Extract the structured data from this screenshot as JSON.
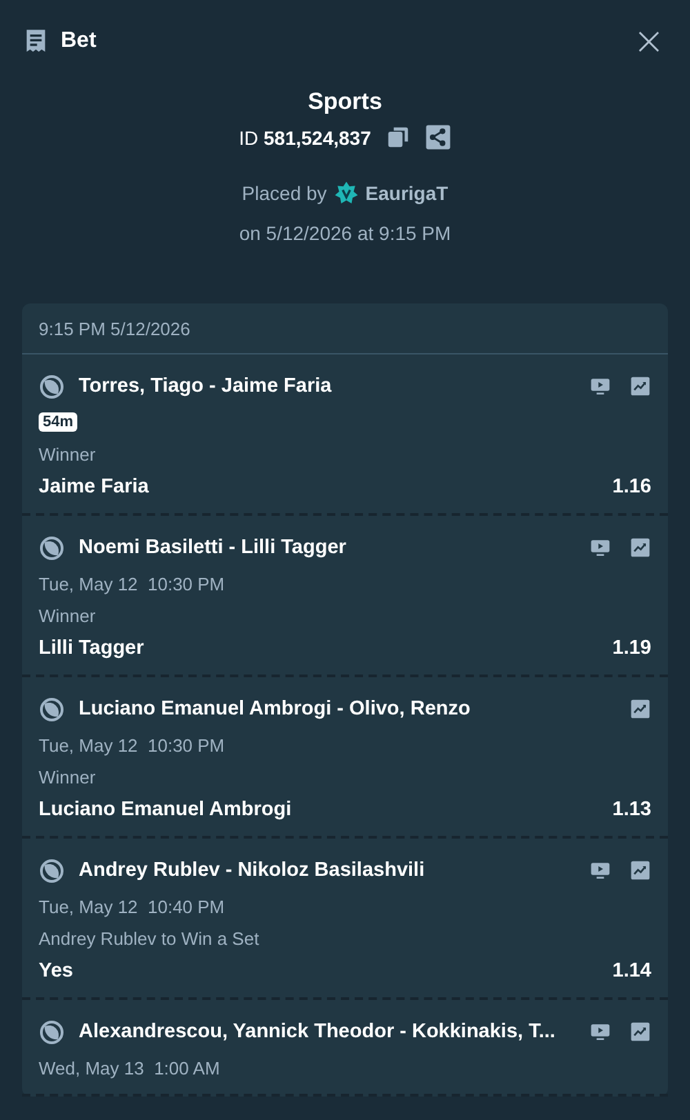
{
  "header": {
    "title": "Bet",
    "close": "×"
  },
  "summary": {
    "category": "Sports",
    "id_label": "ID",
    "id_value": "581,524,837",
    "placed_by": "Placed by",
    "user": "EaurigaT",
    "placed_on": "on 5/12/2026 at 9:15 PM"
  },
  "card": {
    "timestamp": "9:15 PM 5/12/2026",
    "legs": [
      {
        "event": "Torres, Tiago - Jaime Faria",
        "badge": "54m",
        "stream": true,
        "stats": true,
        "market": "Winner",
        "selection": "Jaime Faria",
        "odds": "1.16"
      },
      {
        "event": "Noemi Basiletti - Lilli Tagger",
        "time": "Tue, May 12  10:30 PM",
        "stream": true,
        "stats": true,
        "market": "Winner",
        "selection": "Lilli Tagger",
        "odds": "1.19"
      },
      {
        "event": "Luciano Emanuel Ambrogi - Olivo, Renzo",
        "time": "Tue, May 12  10:30 PM",
        "stream": false,
        "stats": true,
        "market": "Winner",
        "selection": "Luciano Emanuel Ambrogi",
        "odds": "1.13"
      },
      {
        "event": "Andrey Rublev - Nikoloz Basilashvili",
        "time": "Tue, May 12  10:40 PM",
        "stream": true,
        "stats": true,
        "market": "Andrey Rublev to Win a Set",
        "selection": "Yes",
        "odds": "1.14"
      },
      {
        "event": "Alexandrescou, Yannick Theodor - Kokkinakis, T...",
        "time": "Wed, May 13  1:00 AM",
        "stream": true,
        "stats": true
      }
    ]
  }
}
